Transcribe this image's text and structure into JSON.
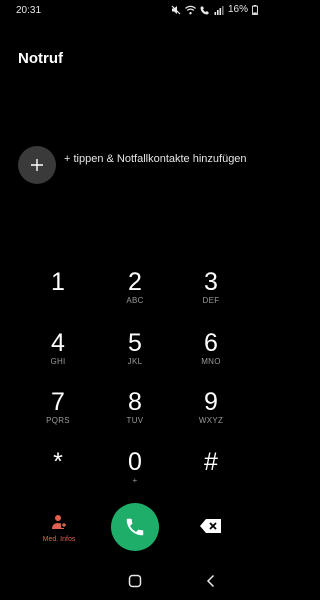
{
  "status": {
    "time": "20:31",
    "battery": "16%"
  },
  "title": "Notruf",
  "add_contact": {
    "text": "+ tippen & Notfallkontakte hinzufügen"
  },
  "keypad": [
    {
      "digit": "1",
      "letters": ""
    },
    {
      "digit": "2",
      "letters": "ABC"
    },
    {
      "digit": "3",
      "letters": "DEF"
    },
    {
      "digit": "4",
      "letters": "GHI"
    },
    {
      "digit": "5",
      "letters": "JKL"
    },
    {
      "digit": "6",
      "letters": "MNO"
    },
    {
      "digit": "7",
      "letters": "PQRS"
    },
    {
      "digit": "8",
      "letters": "TUV"
    },
    {
      "digit": "9",
      "letters": "WXYZ"
    },
    {
      "digit": "*",
      "letters": ""
    },
    {
      "digit": "0",
      "letters": "+"
    },
    {
      "digit": "#",
      "letters": ""
    }
  ],
  "bottom": {
    "med_info_label": "Med. Infos"
  },
  "colors": {
    "background": "#000000",
    "call": "#1fae6a",
    "med_info": "#e0614f",
    "add_circle": "#3a3a3a"
  },
  "icons": [
    "mute-icon",
    "wifi-icon",
    "call-signal-icon",
    "signal-icon",
    "battery-icon",
    "plus-icon",
    "medical-person-icon",
    "phone-icon",
    "backspace-icon",
    "home-icon",
    "back-icon"
  ]
}
